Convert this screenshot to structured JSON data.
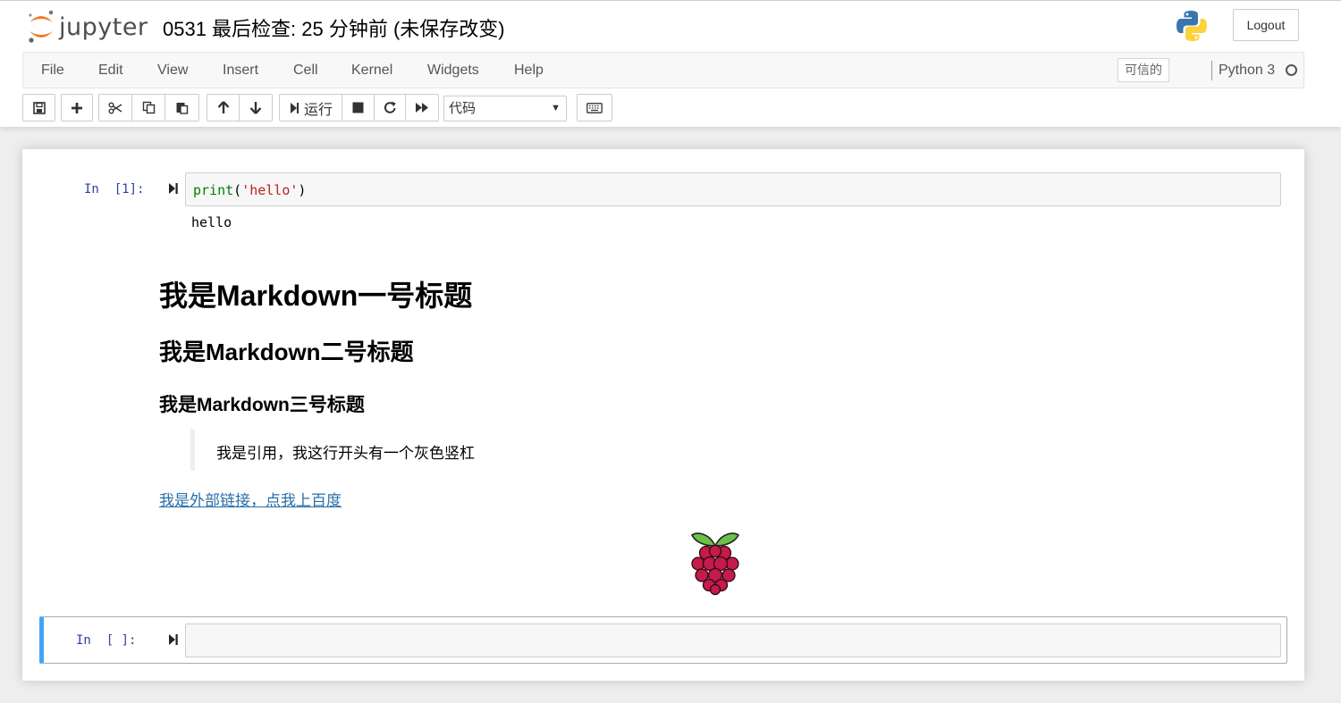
{
  "header": {
    "logo_text": "jupyter",
    "notebook_title": "0531 最后检查: 25 分钟前  (未保存改变)",
    "logout_label": "Logout"
  },
  "menubar": {
    "items": [
      "File",
      "Edit",
      "View",
      "Insert",
      "Cell",
      "Kernel",
      "Widgets",
      "Help"
    ],
    "trusted_label": "可信的",
    "kernel_name": "Python 3"
  },
  "toolbar": {
    "run_label": "运行",
    "cell_type": "代码",
    "icons": [
      "save-icon",
      "plus-icon",
      "cut-icon",
      "copy-icon",
      "paste-icon",
      "arrow-up-icon",
      "arrow-down-icon",
      "run-icon",
      "stop-icon",
      "restart-icon",
      "fast-forward-icon",
      "keyboard-icon"
    ]
  },
  "cells": {
    "cell1": {
      "prompt": "In  [1]:",
      "code_builtin": "print",
      "code_open": "(",
      "code_string": "'hello'",
      "code_close": ")",
      "output": "hello"
    },
    "markdown": {
      "h1": "我是Markdown一号标题",
      "h2": "我是Markdown二号标题",
      "h3": "我是Markdown三号标题",
      "blockquote": "我是引用，我这行开头有一个灰色竖杠",
      "link_text": "我是外部链接，点我上百度"
    },
    "cell2": {
      "prompt": "In  [ ]:",
      "code": ""
    }
  },
  "colors": {
    "link": "#296eaa",
    "prompt": "#303f9f",
    "selected_cell_bar": "#42a5f5",
    "jupyter_orange": "#f37726"
  }
}
